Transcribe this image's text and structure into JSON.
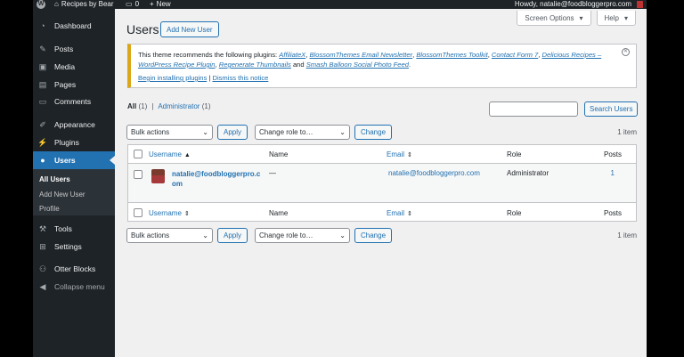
{
  "admin_bar": {
    "site_name": "Recipes by Bear",
    "comments_count": "0",
    "new_label": "New",
    "greeting": "Howdy, natalie@foodbloggerpro.com"
  },
  "sidebar": {
    "items": [
      {
        "label": "Dashboard",
        "icon": "dashboard-icon"
      },
      {
        "label": "Posts",
        "icon": "pin-icon"
      },
      {
        "label": "Media",
        "icon": "media-icon"
      },
      {
        "label": "Pages",
        "icon": "page-icon"
      },
      {
        "label": "Comments",
        "icon": "comment-icon"
      },
      {
        "label": "Appearance",
        "icon": "brush-icon"
      },
      {
        "label": "Plugins",
        "icon": "plugin-icon"
      },
      {
        "label": "Users",
        "icon": "user-icon"
      },
      {
        "label": "Tools",
        "icon": "wrench-icon"
      },
      {
        "label": "Settings",
        "icon": "settings-icon"
      },
      {
        "label": "Otter Blocks",
        "icon": "otter-icon"
      },
      {
        "label": "Collapse menu",
        "icon": "collapse-icon"
      }
    ],
    "submenu": [
      "All Users",
      "Add New User",
      "Profile"
    ]
  },
  "header": {
    "screen_options": "Screen Options",
    "help": "Help",
    "title": "Users",
    "add_new": "Add New User"
  },
  "notice": {
    "intro": "This theme recommends the following plugins: ",
    "plugins": [
      "AffiliateX",
      "BlossomThemes Email Newsletter",
      "BlossomThemes Toolkit",
      "Contact Form 7",
      "Delicious Recipes – WordPress Recipe Plugin",
      "Regenerate Thumbnails",
      "Smash Balloon Social Photo Feed"
    ],
    "and": " and ",
    "begin": "Begin installing plugins",
    "separator": " | ",
    "dismiss": "Dismiss this notice"
  },
  "views": {
    "all": "All",
    "all_count": "(1)",
    "sep": "|",
    "admin": "Administrator",
    "admin_count": "(1)"
  },
  "search": {
    "value": "",
    "button": "Search Users"
  },
  "bulk": {
    "bulk_actions": "Bulk actions",
    "apply": "Apply",
    "change_role": "Change role to…",
    "change": "Change",
    "count": "1 item"
  },
  "table": {
    "columns": [
      "Username",
      "Name",
      "Email",
      "Role",
      "Posts"
    ],
    "rows": [
      {
        "username_line1": "natalie@foodbloggerpro.c",
        "username_line2": "om",
        "name": "—",
        "email": "natalie@foodbloggerpro.com",
        "role": "Administrator",
        "posts": "1"
      }
    ]
  }
}
